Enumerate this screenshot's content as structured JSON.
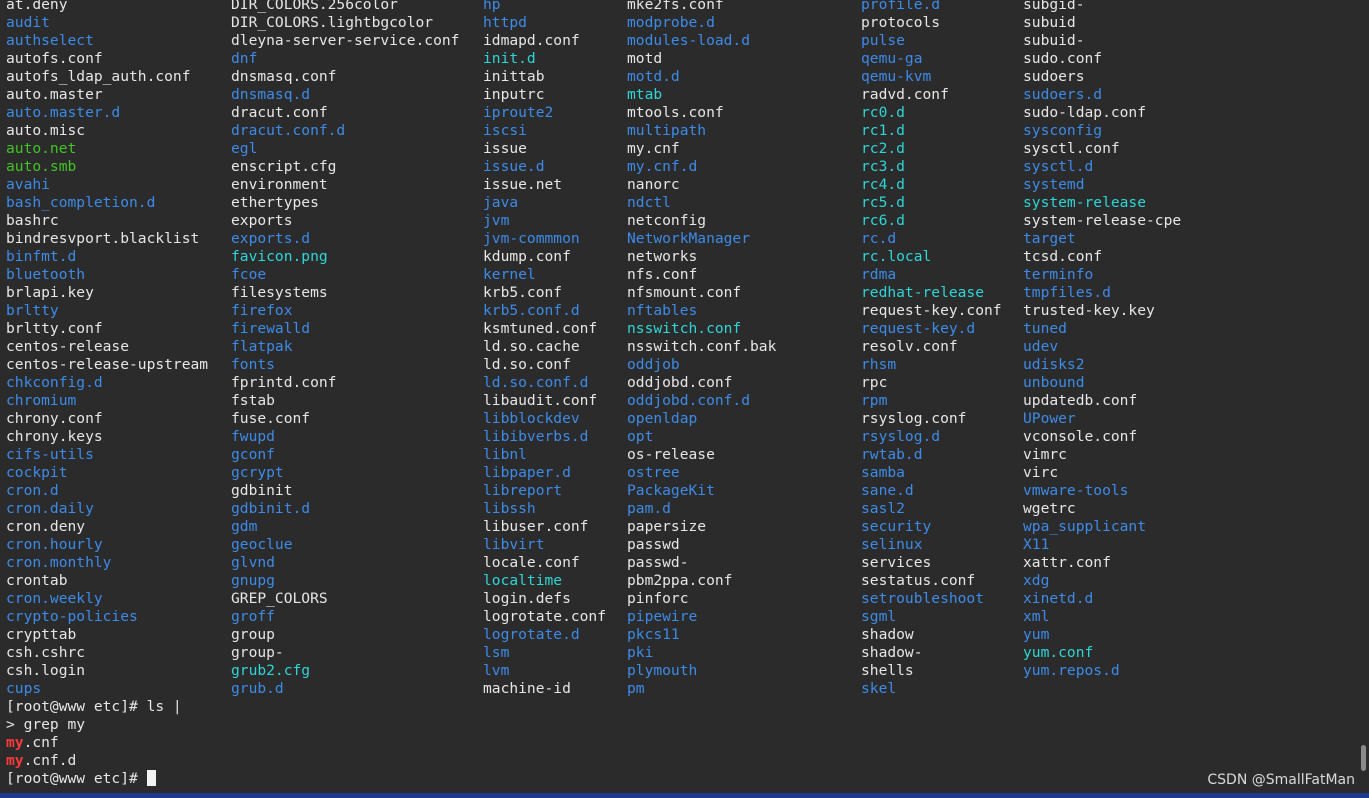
{
  "colors": {
    "background": "#2b2b2b",
    "file": "#e6e6e6",
    "directory": "#3d8be8",
    "symlink": "#2fd6d6",
    "executable": "#41c426",
    "match": "#ff3a3a"
  },
  "listing": {
    "columns": [
      [
        {
          "name": "at.deny",
          "type": "file"
        },
        {
          "name": "audit",
          "type": "dir"
        },
        {
          "name": "authselect",
          "type": "dir"
        },
        {
          "name": "autofs.conf",
          "type": "file"
        },
        {
          "name": "autofs_ldap_auth.conf",
          "type": "file"
        },
        {
          "name": "auto.master",
          "type": "file"
        },
        {
          "name": "auto.master.d",
          "type": "dir"
        },
        {
          "name": "auto.misc",
          "type": "file"
        },
        {
          "name": "auto.net",
          "type": "exec"
        },
        {
          "name": "auto.smb",
          "type": "exec"
        },
        {
          "name": "avahi",
          "type": "dir"
        },
        {
          "name": "bash_completion.d",
          "type": "dir"
        },
        {
          "name": "bashrc",
          "type": "file"
        },
        {
          "name": "bindresvport.blacklist",
          "type": "file"
        },
        {
          "name": "binfmt.d",
          "type": "dir"
        },
        {
          "name": "bluetooth",
          "type": "dir"
        },
        {
          "name": "brlapi.key",
          "type": "file"
        },
        {
          "name": "brltty",
          "type": "dir"
        },
        {
          "name": "brltty.conf",
          "type": "file"
        },
        {
          "name": "centos-release",
          "type": "file"
        },
        {
          "name": "centos-release-upstream",
          "type": "file"
        },
        {
          "name": "chkconfig.d",
          "type": "dir"
        },
        {
          "name": "chromium",
          "type": "dir"
        },
        {
          "name": "chrony.conf",
          "type": "file"
        },
        {
          "name": "chrony.keys",
          "type": "file"
        },
        {
          "name": "cifs-utils",
          "type": "dir"
        },
        {
          "name": "cockpit",
          "type": "dir"
        },
        {
          "name": "cron.d",
          "type": "dir"
        },
        {
          "name": "cron.daily",
          "type": "dir"
        },
        {
          "name": "cron.deny",
          "type": "file"
        },
        {
          "name": "cron.hourly",
          "type": "dir"
        },
        {
          "name": "cron.monthly",
          "type": "dir"
        },
        {
          "name": "crontab",
          "type": "file"
        },
        {
          "name": "cron.weekly",
          "type": "dir"
        },
        {
          "name": "crypto-policies",
          "type": "dir"
        },
        {
          "name": "crypttab",
          "type": "file"
        },
        {
          "name": "csh.cshrc",
          "type": "file"
        },
        {
          "name": "csh.login",
          "type": "file"
        },
        {
          "name": "cups",
          "type": "dir"
        }
      ],
      [
        {
          "name": "DIR_COLORS.256color",
          "type": "file"
        },
        {
          "name": "DIR_COLORS.lightbgcolor",
          "type": "file"
        },
        {
          "name": "dleyna-server-service.conf",
          "type": "file"
        },
        {
          "name": "dnf",
          "type": "dir"
        },
        {
          "name": "dnsmasq.conf",
          "type": "file"
        },
        {
          "name": "dnsmasq.d",
          "type": "dir"
        },
        {
          "name": "dracut.conf",
          "type": "file"
        },
        {
          "name": "dracut.conf.d",
          "type": "dir"
        },
        {
          "name": "egl",
          "type": "dir"
        },
        {
          "name": "enscript.cfg",
          "type": "file"
        },
        {
          "name": "environment",
          "type": "file"
        },
        {
          "name": "ethertypes",
          "type": "file"
        },
        {
          "name": "exports",
          "type": "file"
        },
        {
          "name": "exports.d",
          "type": "dir"
        },
        {
          "name": "favicon.png",
          "type": "link"
        },
        {
          "name": "fcoe",
          "type": "dir"
        },
        {
          "name": "filesystems",
          "type": "file"
        },
        {
          "name": "firefox",
          "type": "dir"
        },
        {
          "name": "firewalld",
          "type": "dir"
        },
        {
          "name": "flatpak",
          "type": "dir"
        },
        {
          "name": "fonts",
          "type": "dir"
        },
        {
          "name": "fprintd.conf",
          "type": "file"
        },
        {
          "name": "fstab",
          "type": "file"
        },
        {
          "name": "fuse.conf",
          "type": "file"
        },
        {
          "name": "fwupd",
          "type": "dir"
        },
        {
          "name": "gconf",
          "type": "dir"
        },
        {
          "name": "gcrypt",
          "type": "dir"
        },
        {
          "name": "gdbinit",
          "type": "file"
        },
        {
          "name": "gdbinit.d",
          "type": "dir"
        },
        {
          "name": "gdm",
          "type": "dir"
        },
        {
          "name": "geoclue",
          "type": "dir"
        },
        {
          "name": "glvnd",
          "type": "dir"
        },
        {
          "name": "gnupg",
          "type": "dir"
        },
        {
          "name": "GREP_COLORS",
          "type": "file"
        },
        {
          "name": "groff",
          "type": "dir"
        },
        {
          "name": "group",
          "type": "file"
        },
        {
          "name": "group-",
          "type": "file"
        },
        {
          "name": "grub2.cfg",
          "type": "link"
        },
        {
          "name": "grub.d",
          "type": "dir"
        }
      ],
      [
        {
          "name": "hp",
          "type": "dir"
        },
        {
          "name": "httpd",
          "type": "dir"
        },
        {
          "name": "idmapd.conf",
          "type": "file"
        },
        {
          "name": "init.d",
          "type": "link"
        },
        {
          "name": "inittab",
          "type": "file"
        },
        {
          "name": "inputrc",
          "type": "file"
        },
        {
          "name": "iproute2",
          "type": "dir"
        },
        {
          "name": "iscsi",
          "type": "dir"
        },
        {
          "name": "issue",
          "type": "file"
        },
        {
          "name": "issue.d",
          "type": "dir"
        },
        {
          "name": "issue.net",
          "type": "file"
        },
        {
          "name": "java",
          "type": "dir"
        },
        {
          "name": "jvm",
          "type": "dir"
        },
        {
          "name": "jvm-commmon",
          "type": "dir"
        },
        {
          "name": "kdump.conf",
          "type": "file"
        },
        {
          "name": "kernel",
          "type": "dir"
        },
        {
          "name": "krb5.conf",
          "type": "file"
        },
        {
          "name": "krb5.conf.d",
          "type": "dir"
        },
        {
          "name": "ksmtuned.conf",
          "type": "file"
        },
        {
          "name": "ld.so.cache",
          "type": "file"
        },
        {
          "name": "ld.so.conf",
          "type": "file"
        },
        {
          "name": "ld.so.conf.d",
          "type": "dir"
        },
        {
          "name": "libaudit.conf",
          "type": "file"
        },
        {
          "name": "libblockdev",
          "type": "dir"
        },
        {
          "name": "libibverbs.d",
          "type": "dir"
        },
        {
          "name": "libnl",
          "type": "dir"
        },
        {
          "name": "libpaper.d",
          "type": "dir"
        },
        {
          "name": "libreport",
          "type": "dir"
        },
        {
          "name": "libssh",
          "type": "dir"
        },
        {
          "name": "libuser.conf",
          "type": "file"
        },
        {
          "name": "libvirt",
          "type": "dir"
        },
        {
          "name": "locale.conf",
          "type": "file"
        },
        {
          "name": "localtime",
          "type": "link"
        },
        {
          "name": "login.defs",
          "type": "file"
        },
        {
          "name": "logrotate.conf",
          "type": "file"
        },
        {
          "name": "logrotate.d",
          "type": "dir"
        },
        {
          "name": "lsm",
          "type": "dir"
        },
        {
          "name": "lvm",
          "type": "dir"
        },
        {
          "name": "machine-id",
          "type": "file"
        }
      ],
      [
        {
          "name": "mke2fs.conf",
          "type": "file"
        },
        {
          "name": "modprobe.d",
          "type": "dir"
        },
        {
          "name": "modules-load.d",
          "type": "dir"
        },
        {
          "name": "motd",
          "type": "file"
        },
        {
          "name": "motd.d",
          "type": "dir"
        },
        {
          "name": "mtab",
          "type": "link"
        },
        {
          "name": "mtools.conf",
          "type": "file"
        },
        {
          "name": "multipath",
          "type": "dir"
        },
        {
          "name": "my.cnf",
          "type": "file"
        },
        {
          "name": "my.cnf.d",
          "type": "dir"
        },
        {
          "name": "nanorc",
          "type": "file"
        },
        {
          "name": "ndctl",
          "type": "dir"
        },
        {
          "name": "netconfig",
          "type": "file"
        },
        {
          "name": "NetworkManager",
          "type": "dir"
        },
        {
          "name": "networks",
          "type": "file"
        },
        {
          "name": "nfs.conf",
          "type": "file"
        },
        {
          "name": "nfsmount.conf",
          "type": "file"
        },
        {
          "name": "nftables",
          "type": "dir"
        },
        {
          "name": "nsswitch.conf",
          "type": "link"
        },
        {
          "name": "nsswitch.conf.bak",
          "type": "file"
        },
        {
          "name": "oddjob",
          "type": "dir"
        },
        {
          "name": "oddjobd.conf",
          "type": "file"
        },
        {
          "name": "oddjobd.conf.d",
          "type": "dir"
        },
        {
          "name": "openldap",
          "type": "dir"
        },
        {
          "name": "opt",
          "type": "dir"
        },
        {
          "name": "os-release",
          "type": "file"
        },
        {
          "name": "ostree",
          "type": "dir"
        },
        {
          "name": "PackageKit",
          "type": "dir"
        },
        {
          "name": "pam.d",
          "type": "dir"
        },
        {
          "name": "papersize",
          "type": "file"
        },
        {
          "name": "passwd",
          "type": "file"
        },
        {
          "name": "passwd-",
          "type": "file"
        },
        {
          "name": "pbm2ppa.conf",
          "type": "file"
        },
        {
          "name": "pinforc",
          "type": "file"
        },
        {
          "name": "pipewire",
          "type": "dir"
        },
        {
          "name": "pkcs11",
          "type": "dir"
        },
        {
          "name": "pki",
          "type": "dir"
        },
        {
          "name": "plymouth",
          "type": "dir"
        },
        {
          "name": "pm",
          "type": "dir"
        }
      ],
      [
        {
          "name": "profile.d",
          "type": "dir"
        },
        {
          "name": "protocols",
          "type": "file"
        },
        {
          "name": "pulse",
          "type": "dir"
        },
        {
          "name": "qemu-ga",
          "type": "dir"
        },
        {
          "name": "qemu-kvm",
          "type": "dir"
        },
        {
          "name": "radvd.conf",
          "type": "file"
        },
        {
          "name": "rc0.d",
          "type": "link"
        },
        {
          "name": "rc1.d",
          "type": "link"
        },
        {
          "name": "rc2.d",
          "type": "link"
        },
        {
          "name": "rc3.d",
          "type": "link"
        },
        {
          "name": "rc4.d",
          "type": "link"
        },
        {
          "name": "rc5.d",
          "type": "link"
        },
        {
          "name": "rc6.d",
          "type": "link"
        },
        {
          "name": "rc.d",
          "type": "dir"
        },
        {
          "name": "rc.local",
          "type": "link"
        },
        {
          "name": "rdma",
          "type": "dir"
        },
        {
          "name": "redhat-release",
          "type": "link"
        },
        {
          "name": "request-key.conf",
          "type": "file"
        },
        {
          "name": "request-key.d",
          "type": "dir"
        },
        {
          "name": "resolv.conf",
          "type": "file"
        },
        {
          "name": "rhsm",
          "type": "dir"
        },
        {
          "name": "rpc",
          "type": "file"
        },
        {
          "name": "rpm",
          "type": "dir"
        },
        {
          "name": "rsyslog.conf",
          "type": "file"
        },
        {
          "name": "rsyslog.d",
          "type": "dir"
        },
        {
          "name": "rwtab.d",
          "type": "dir"
        },
        {
          "name": "samba",
          "type": "dir"
        },
        {
          "name": "sane.d",
          "type": "dir"
        },
        {
          "name": "sasl2",
          "type": "dir"
        },
        {
          "name": "security",
          "type": "dir"
        },
        {
          "name": "selinux",
          "type": "dir"
        },
        {
          "name": "services",
          "type": "file"
        },
        {
          "name": "sestatus.conf",
          "type": "file"
        },
        {
          "name": "setroubleshoot",
          "type": "dir"
        },
        {
          "name": "sgml",
          "type": "dir"
        },
        {
          "name": "shadow",
          "type": "file"
        },
        {
          "name": "shadow-",
          "type": "file"
        },
        {
          "name": "shells",
          "type": "file"
        },
        {
          "name": "skel",
          "type": "dir"
        }
      ],
      [
        {
          "name": "subgid-",
          "type": "file"
        },
        {
          "name": "subuid",
          "type": "file"
        },
        {
          "name": "subuid-",
          "type": "file"
        },
        {
          "name": "sudo.conf",
          "type": "file"
        },
        {
          "name": "sudoers",
          "type": "file"
        },
        {
          "name": "sudoers.d",
          "type": "dir"
        },
        {
          "name": "sudo-ldap.conf",
          "type": "file"
        },
        {
          "name": "sysconfig",
          "type": "dir"
        },
        {
          "name": "sysctl.conf",
          "type": "file"
        },
        {
          "name": "sysctl.d",
          "type": "dir"
        },
        {
          "name": "systemd",
          "type": "dir"
        },
        {
          "name": "system-release",
          "type": "link"
        },
        {
          "name": "system-release-cpe",
          "type": "file"
        },
        {
          "name": "target",
          "type": "dir"
        },
        {
          "name": "tcsd.conf",
          "type": "file"
        },
        {
          "name": "terminfo",
          "type": "dir"
        },
        {
          "name": "tmpfiles.d",
          "type": "dir"
        },
        {
          "name": "trusted-key.key",
          "type": "file"
        },
        {
          "name": "tuned",
          "type": "dir"
        },
        {
          "name": "udev",
          "type": "dir"
        },
        {
          "name": "udisks2",
          "type": "dir"
        },
        {
          "name": "unbound",
          "type": "dir"
        },
        {
          "name": "updatedb.conf",
          "type": "file"
        },
        {
          "name": "UPower",
          "type": "dir"
        },
        {
          "name": "vconsole.conf",
          "type": "file"
        },
        {
          "name": "vimrc",
          "type": "file"
        },
        {
          "name": "virc",
          "type": "file"
        },
        {
          "name": "vmware-tools",
          "type": "dir"
        },
        {
          "name": "wgetrc",
          "type": "file"
        },
        {
          "name": "wpa_supplicant",
          "type": "dir"
        },
        {
          "name": "X11",
          "type": "dir"
        },
        {
          "name": "xattr.conf",
          "type": "file"
        },
        {
          "name": "xdg",
          "type": "dir"
        },
        {
          "name": "xinetd.d",
          "type": "dir"
        },
        {
          "name": "xml",
          "type": "dir"
        },
        {
          "name": "yum",
          "type": "dir"
        },
        {
          "name": "yum.conf",
          "type": "link"
        },
        {
          "name": "yum.repos.d",
          "type": "dir"
        }
      ]
    ]
  },
  "session": {
    "command_line_1": "[root@www etc]# ls |",
    "command_line_2": "> grep my",
    "results": [
      {
        "match": "my",
        "rest": ".cnf"
      },
      {
        "match": "my",
        "rest": ".cnf.d"
      }
    ],
    "prompt": "[root@www etc]# "
  },
  "watermark": "CSDN @SmallFatMan"
}
